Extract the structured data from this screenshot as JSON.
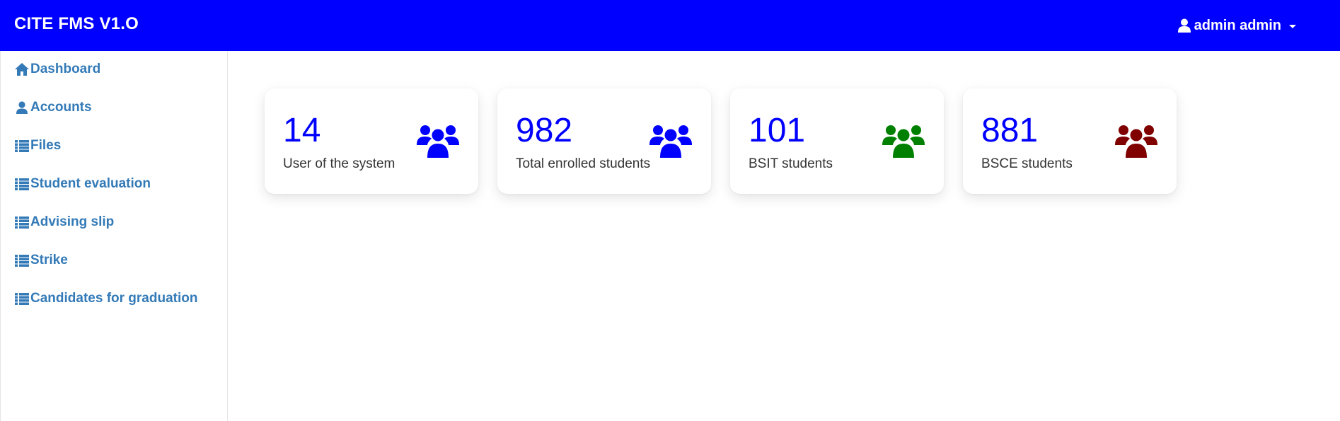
{
  "app": {
    "title": "CITE FMS V1.O"
  },
  "user": {
    "name": "admin admin",
    "icon": "user-icon"
  },
  "sidebar": {
    "items": [
      {
        "label": "Dashboard",
        "icon": "home-icon"
      },
      {
        "label": "Accounts",
        "icon": "user-icon"
      },
      {
        "label": "Files",
        "icon": "list-icon"
      },
      {
        "label": "Student evaluation",
        "icon": "list-icon"
      },
      {
        "label": "Advising slip",
        "icon": "list-icon"
      },
      {
        "label": "Strike",
        "icon": "list-icon"
      },
      {
        "label": "Candidates for graduation",
        "icon": "list-icon"
      }
    ]
  },
  "cards": [
    {
      "value": "14",
      "label": "User of the system",
      "icon": "users-icon",
      "icon_color": "#0000ff"
    },
    {
      "value": "982",
      "label": "Total enrolled students",
      "icon": "users-icon",
      "icon_color": "#0000ff"
    },
    {
      "value": "101",
      "label": "BSIT students",
      "icon": "users-icon",
      "icon_color": "#008000"
    },
    {
      "value": "881",
      "label": "BSCE students",
      "icon": "users-icon",
      "icon_color": "#800000"
    }
  ],
  "colors": {
    "topbar": "#0000ff",
    "link": "#337ab7",
    "card_value": "#0000ff"
  }
}
